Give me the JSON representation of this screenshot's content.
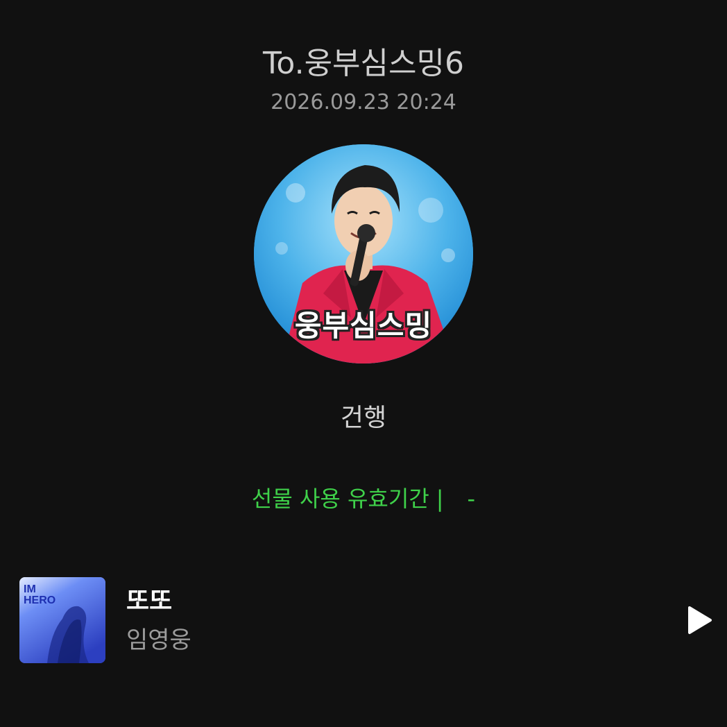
{
  "header": {
    "title": "To.웅부심스밍6",
    "timestamp": "2026.09.23 20:24"
  },
  "profile": {
    "avatar_caption": "웅부심스밍"
  },
  "message": {
    "sender": "건행"
  },
  "gift": {
    "validity_label": "선물 사용 유효기간",
    "separator": "|",
    "validity_value": "-",
    "accent_color": "#3fd14a"
  },
  "track": {
    "title": "또또",
    "artist": "임영웅",
    "album_art_text": [
      "IM",
      "HERO"
    ],
    "play_icon": "play-icon"
  },
  "colors": {
    "background": "#111111",
    "text_primary": "#ffffff",
    "text_secondary": "#9c9c9c"
  }
}
